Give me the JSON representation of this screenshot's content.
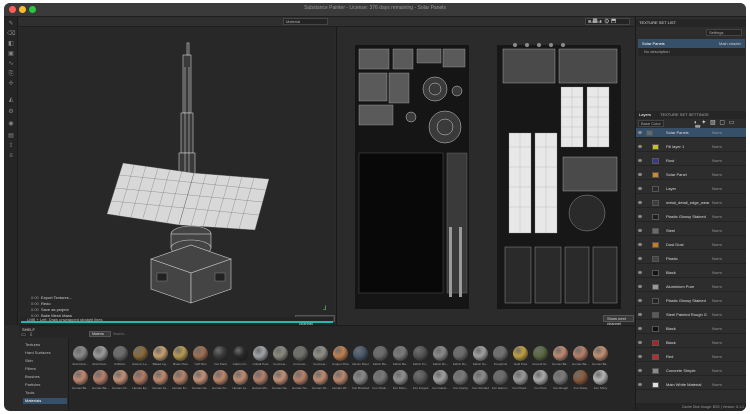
{
  "app": {
    "title": "Substance Painter - License: 376 days remaining - Solar Panels"
  },
  "viewport_3d": {
    "mode_label": "Material",
    "log": [
      {
        "time": "0:00",
        "text": "Export Textures..."
      },
      {
        "time": "0:00",
        "text": "Redo"
      },
      {
        "time": "0:00",
        "text": "Save as project"
      },
      {
        "time": "0:00",
        "text": "Bake Mesh Maps"
      }
    ],
    "status_text": "LMB + Left: Draw unwrapped straight lines",
    "show_next_label": "Show next channel"
  },
  "viewport_2d": {
    "mode_label": "Material",
    "show_next_label": "Show next channel"
  },
  "texture_set_list": {
    "header": "Texture Set List",
    "settings_label": "Settings",
    "selected_set": "Solar Panels",
    "shader_label": "Main shader",
    "description": "No description"
  },
  "layers_panel": {
    "tab_layers": "Layers",
    "tab_settings": "Texture Set Settings",
    "base_color_label": "Base Color",
    "layers": [
      {
        "name": "Solar Panels",
        "blend": "Norm",
        "thumb_color": "#5c6d7a",
        "selected": true,
        "indent": 0
      },
      {
        "name": "Fill layer 1",
        "blend": "Norm",
        "thumb_color": "#c8c020",
        "selected": false,
        "indent": 1
      },
      {
        "name": "Rust",
        "blend": "Norm",
        "thumb_color": "#3a3a8a",
        "selected": false,
        "indent": 1
      },
      {
        "name": "Solar Panel",
        "blend": "Norm",
        "thumb_color": "#d08a20",
        "selected": false,
        "indent": 1
      },
      {
        "name": "Layer",
        "blend": "Norm",
        "thumb_color": "#2b2b2b",
        "selected": false,
        "indent": 1
      },
      {
        "name": "metal_detail_edge_wear",
        "blend": "Norm",
        "thumb_color": "#3d3d3d",
        "selected": false,
        "indent": 1
      },
      {
        "name": "Plastic Glossy Stained",
        "blend": "Norm",
        "thumb_color": "#1f1f1f",
        "selected": false,
        "indent": 1
      },
      {
        "name": "Steel",
        "blend": "Norm",
        "thumb_color": "#6a6a6a",
        "selected": false,
        "indent": 1
      },
      {
        "name": "Dust Dust",
        "blend": "Norm",
        "thumb_color": "#c87a20",
        "selected": false,
        "indent": 1
      },
      {
        "name": "Plastic",
        "blend": "Norm",
        "thumb_color": "#444444",
        "selected": false,
        "indent": 1
      },
      {
        "name": "Black",
        "blend": "Norm",
        "thumb_color": "#141414",
        "selected": false,
        "indent": 1
      },
      {
        "name": "Aluminium Pure",
        "blend": "Norm",
        "thumb_color": "#9a9a9a",
        "selected": false,
        "indent": 1
      },
      {
        "name": "Plastic Glossy Stained",
        "blend": "Norm",
        "thumb_color": "#242424",
        "selected": false,
        "indent": 1
      },
      {
        "name": "Steel Painted Rough G",
        "blend": "Norm",
        "thumb_color": "#5a5a5a",
        "selected": false,
        "indent": 1
      },
      {
        "name": "Black",
        "blend": "Norm",
        "thumb_color": "#111111",
        "selected": false,
        "indent": 1
      },
      {
        "name": "Black",
        "blend": "Norm",
        "thumb_color": "#b02020",
        "selected": false,
        "indent": 1
      },
      {
        "name": "Red",
        "blend": "Norm",
        "thumb_color": "#c02a2a",
        "selected": false,
        "indent": 1
      },
      {
        "name": "Concrete Simple",
        "blend": "Norm",
        "thumb_color": "#8a8a8a",
        "selected": false,
        "indent": 1
      },
      {
        "name": "Main White Material",
        "blend": "Norm",
        "thumb_color": "#e0e0e0",
        "selected": false,
        "indent": 1
      }
    ],
    "footer_cache": "Cache Disk Usage:",
    "footer_version": "BSS | Version: 6.1.1"
  },
  "shelf": {
    "header": "Shelf",
    "search_placeholder": "Search...",
    "filter_chip": "Materia",
    "categories": [
      {
        "label": "Textures",
        "selected": false
      },
      {
        "label": "Hard Surfaces",
        "selected": false
      },
      {
        "label": "Skin",
        "selected": false
      },
      {
        "label": "Filters",
        "selected": false
      },
      {
        "label": "Brushes",
        "selected": false
      },
      {
        "label": "Particles",
        "selected": false
      },
      {
        "label": "Tools",
        "selected": false
      },
      {
        "label": "Materials",
        "selected": true
      }
    ],
    "row1": [
      {
        "label": "Aluminium...",
        "color": "#8a8a8a"
      },
      {
        "label": "Aluminium...",
        "color": "#9b9b9b"
      },
      {
        "label": "Artificial...",
        "color": "#6a6a6a"
      },
      {
        "label": "Autumn Le...",
        "color": "#8a6a3a"
      },
      {
        "label": "Baked Lig...",
        "color": "#c8a070"
      },
      {
        "label": "Brass Pure",
        "color": "#b89a50"
      },
      {
        "label": "Calf Skin",
        "color": "#a07050"
      },
      {
        "label": "Car Paint",
        "color": "#3a3a3a"
      },
      {
        "label": "Carbon Fi...",
        "color": "#2a2a2a"
      },
      {
        "label": "Cobalt Pure",
        "color": "#a0a4a8"
      },
      {
        "label": "Concrete...",
        "color": "#8a8a80"
      },
      {
        "label": "Concrete...",
        "color": "#707068"
      },
      {
        "label": "Concrete...",
        "color": "#909088"
      },
      {
        "label": "Copper Pure",
        "color": "#c08050"
      },
      {
        "label": "Denim Rivet",
        "color": "#4a5a70"
      },
      {
        "label": "Fabric Ba...",
        "color": "#6a6a6a"
      },
      {
        "label": "Fabric Ba...",
        "color": "#7a7a7a"
      },
      {
        "label": "Fabric Kn...",
        "color": "#555555"
      },
      {
        "label": "Fabric Ro...",
        "color": "#8a8a8a"
      },
      {
        "label": "Fabric Ro...",
        "color": "#6b6b6b"
      },
      {
        "label": "Fabric So...",
        "color": "#a0a0a0"
      },
      {
        "label": "Footprints",
        "color": "#707070"
      },
      {
        "label": "Gold Pure",
        "color": "#c0a040"
      },
      {
        "label": "Ground Gr...",
        "color": "#5a6a40"
      },
      {
        "label": "Human Ba...",
        "color": "#c08a70"
      },
      {
        "label": "Human Ba...",
        "color": "#b88068"
      },
      {
        "label": "Human Ba...",
        "color": "#c49070"
      }
    ],
    "row2": [
      {
        "label": "Human Be...",
        "color": "#c08870"
      },
      {
        "label": "Human Ba...",
        "color": "#b8806a"
      },
      {
        "label": "Human Ch...",
        "color": "#c49074"
      },
      {
        "label": "Human Ey...",
        "color": "#b47c64"
      },
      {
        "label": "Human Fe...",
        "color": "#c08a6e"
      },
      {
        "label": "Human Fo...",
        "color": "#b88468"
      },
      {
        "label": "Human He...",
        "color": "#c49276"
      },
      {
        "label": "Human Kn...",
        "color": "#bc866a"
      },
      {
        "label": "Human Le...",
        "color": "#c08c70"
      },
      {
        "label": "Human Mo...",
        "color": "#b4806a"
      },
      {
        "label": "Human Ne...",
        "color": "#c49074"
      },
      {
        "label": "Human No...",
        "color": "#b8826a"
      },
      {
        "label": "Human Sh...",
        "color": "#c08a70"
      },
      {
        "label": "Human Wr...",
        "color": "#bc886c"
      },
      {
        "label": "Iron Brushed",
        "color": "#8a8a8a"
      },
      {
        "label": "Iron Chain...",
        "color": "#777777"
      },
      {
        "label": "Iron Diam...",
        "color": "#909090"
      },
      {
        "label": "Iron Forged",
        "color": "#5a5a5a"
      },
      {
        "label": "Iron Galva...",
        "color": "#a0a0a0"
      },
      {
        "label": "Iron Grainy",
        "color": "#7a7a7a"
      },
      {
        "label": "Iron Grinded",
        "color": "#8c8c8c"
      },
      {
        "label": "Iron Hamm...",
        "color": "#6a6a6a"
      },
      {
        "label": "Iron Powd...",
        "color": "#9a9a9a"
      },
      {
        "label": "Iron Pure",
        "color": "#aaaaaa"
      },
      {
        "label": "Iron Rough",
        "color": "#7c7c7c"
      },
      {
        "label": "Iron Rusty",
        "color": "#8a5a3a"
      },
      {
        "label": "Iron Shiny",
        "color": "#b4b4b4"
      }
    ]
  }
}
